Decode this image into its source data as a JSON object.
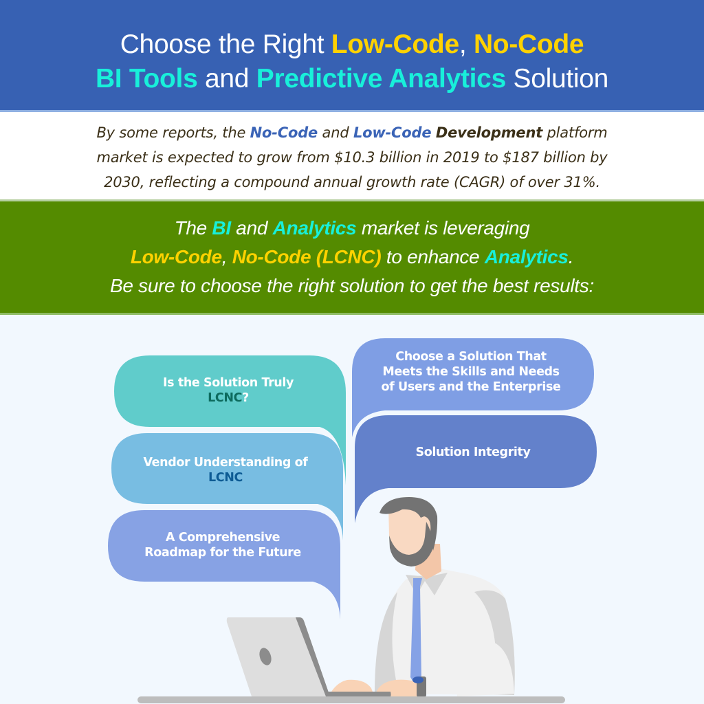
{
  "header": {
    "line1": {
      "prefix": "Choose the Right ",
      "highlight1": "Low-Code",
      "sep": ", ",
      "highlight2": "No-Code"
    },
    "line2": {
      "highlight1": "BI Tools",
      "mid": " and ",
      "highlight2": "Predictive Analytics",
      "suffix": " Solution"
    }
  },
  "intro": {
    "part1": "By some reports, the ",
    "nocode": "No-Code",
    "part2": " and ",
    "lowcode": "Low-Code",
    "part3": " ",
    "development": "Development",
    "part4": " platform",
    "line2": "market is expected to grow from $10.3 billion in 2019 to $187 billion by",
    "line3": "2030, reflecting a compound annual growth rate (CAGR) of over 31%."
  },
  "lcnc": {
    "l1a": "The ",
    "bi": "BI",
    "l1b": " and ",
    "analytics": "Analytics",
    "l1c": " market is leveraging",
    "l2a": "Low-Code",
    "l2b": ", ",
    "l2c": "No-Code (LCNC)",
    "l2d": " to enhance ",
    "l2e": "Analytics",
    "l2f": ".",
    "l3": "Be sure to choose the right solution to get the best results:"
  },
  "bubbles": {
    "left": [
      {
        "text": "Is the Solution Truly",
        "accent": "LCNC",
        "tail": "?",
        "color": "#60cccb"
      },
      {
        "text": "Vendor Understanding of",
        "accent": "LCNC",
        "tail": "",
        "color": "#78bde2"
      },
      {
        "line1": "A Comprehensive",
        "line2": "Roadmap for the Future",
        "color": "#87a2e4"
      }
    ],
    "right": [
      {
        "line1": "Choose a Solution That",
        "line2": "Meets the Skills and Needs",
        "line3": "of Users and the Enterprise",
        "color": "#7f9ee4"
      },
      {
        "text": "Solution Integrity",
        "color": "#6381cb"
      }
    ]
  },
  "illustration": {
    "subject": "man-typing-on-laptop-icon",
    "colors": {
      "hair": "#737373",
      "skin": "#f9d9c2",
      "shirt": "#f1f1f1",
      "shirt_shadow": "#d6d6d6",
      "tie": "#85a2e6",
      "laptop": "#dedede",
      "desk": "#bdbdbd"
    }
  }
}
